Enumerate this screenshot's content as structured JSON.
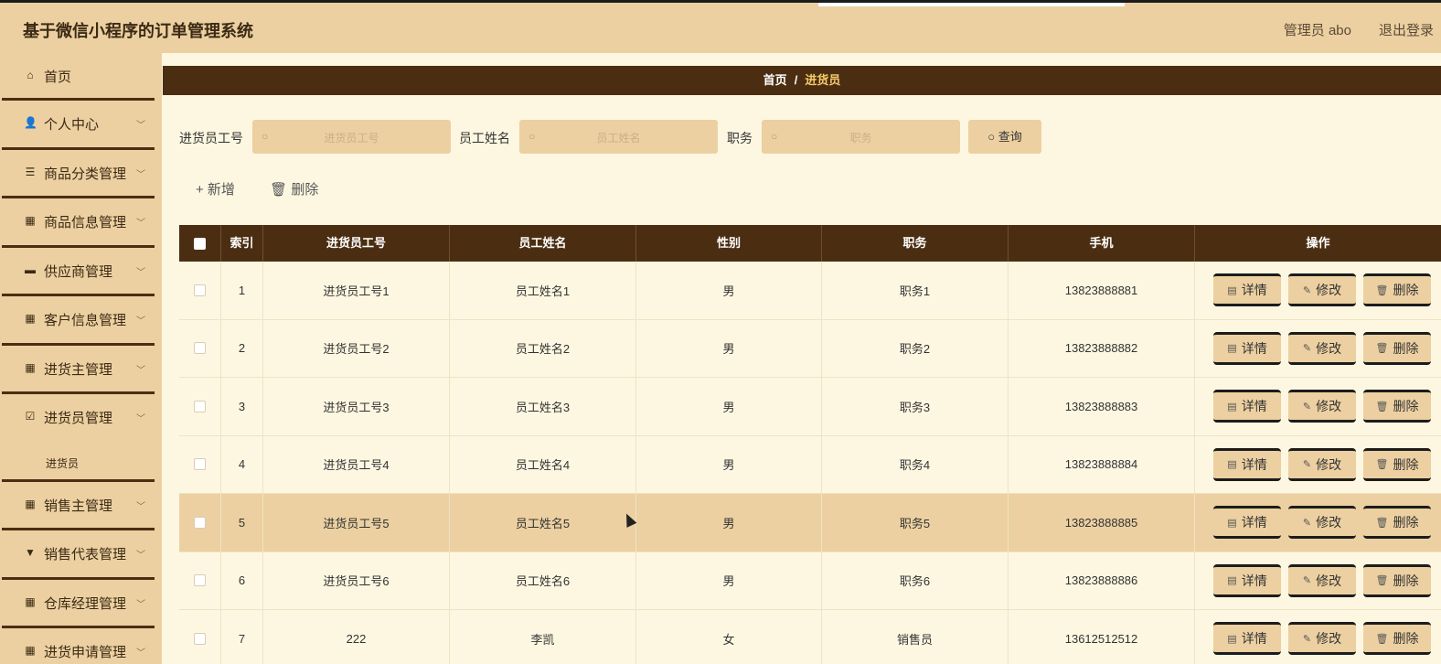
{
  "header": {
    "title": "基于微信小程序的订单管理系统",
    "user": "管理员 abo",
    "logout": "退出登录"
  },
  "sidebar": {
    "items": [
      {
        "icon": "⌂",
        "label": "首页"
      },
      {
        "icon": "👤",
        "label": "个人中心"
      },
      {
        "icon": "☰",
        "label": "商品分类管理"
      },
      {
        "icon": "▦",
        "label": "商品信息管理"
      },
      {
        "icon": "▬",
        "label": "供应商管理"
      },
      {
        "icon": "▦",
        "label": "客户信息管理"
      },
      {
        "icon": "▦",
        "label": "进货主管理"
      },
      {
        "icon": "☑",
        "label": "进货员管理"
      },
      {
        "icon": "▦",
        "label": "销售主管理"
      },
      {
        "icon": "▼",
        "label": "销售代表管理"
      },
      {
        "icon": "▦",
        "label": "仓库经理管理"
      },
      {
        "icon": "▦",
        "label": "进货申请管理"
      }
    ],
    "submenu_label": "进货员"
  },
  "breadcrumb": {
    "home": "首页",
    "sep": "/",
    "current": "进货员"
  },
  "search": {
    "field1_label": "进货员工号",
    "field1_placeholder": "进货员工号",
    "field2_label": "员工姓名",
    "field2_placeholder": "员工姓名",
    "field3_label": "职务",
    "field3_placeholder": "职务",
    "query_label": "查询"
  },
  "actions": {
    "add": "+ 新增",
    "delete": "🗑 删除"
  },
  "table": {
    "headers": [
      "索引",
      "进货员工号",
      "员工姓名",
      "性别",
      "职务",
      "手机",
      "操作"
    ],
    "rows": [
      {
        "index": "1",
        "no": "进货员工号1",
        "name": "员工姓名1",
        "gender": "男",
        "job": "职务1",
        "phone": "13823888881"
      },
      {
        "index": "2",
        "no": "进货员工号2",
        "name": "员工姓名2",
        "gender": "男",
        "job": "职务2",
        "phone": "13823888882"
      },
      {
        "index": "3",
        "no": "进货员工号3",
        "name": "员工姓名3",
        "gender": "男",
        "job": "职务3",
        "phone": "13823888883"
      },
      {
        "index": "4",
        "no": "进货员工号4",
        "name": "员工姓名4",
        "gender": "男",
        "job": "职务4",
        "phone": "13823888884"
      },
      {
        "index": "5",
        "no": "进货员工号5",
        "name": "员工姓名5",
        "gender": "男",
        "job": "职务5",
        "phone": "13823888885"
      },
      {
        "index": "6",
        "no": "进货员工号6",
        "name": "员工姓名6",
        "gender": "男",
        "job": "职务6",
        "phone": "13823888886"
      },
      {
        "index": "7",
        "no": "222",
        "name": "李凯",
        "gender": "女",
        "job": "销售员",
        "phone": "13612512512"
      }
    ],
    "op_detail": "详情",
    "op_edit": "修改",
    "op_delete": "删除"
  },
  "colors": {
    "accent": "#ecd0a1",
    "dark": "#4b2e12",
    "bg": "#fdf7e1",
    "highlight": "#f5c96a"
  }
}
